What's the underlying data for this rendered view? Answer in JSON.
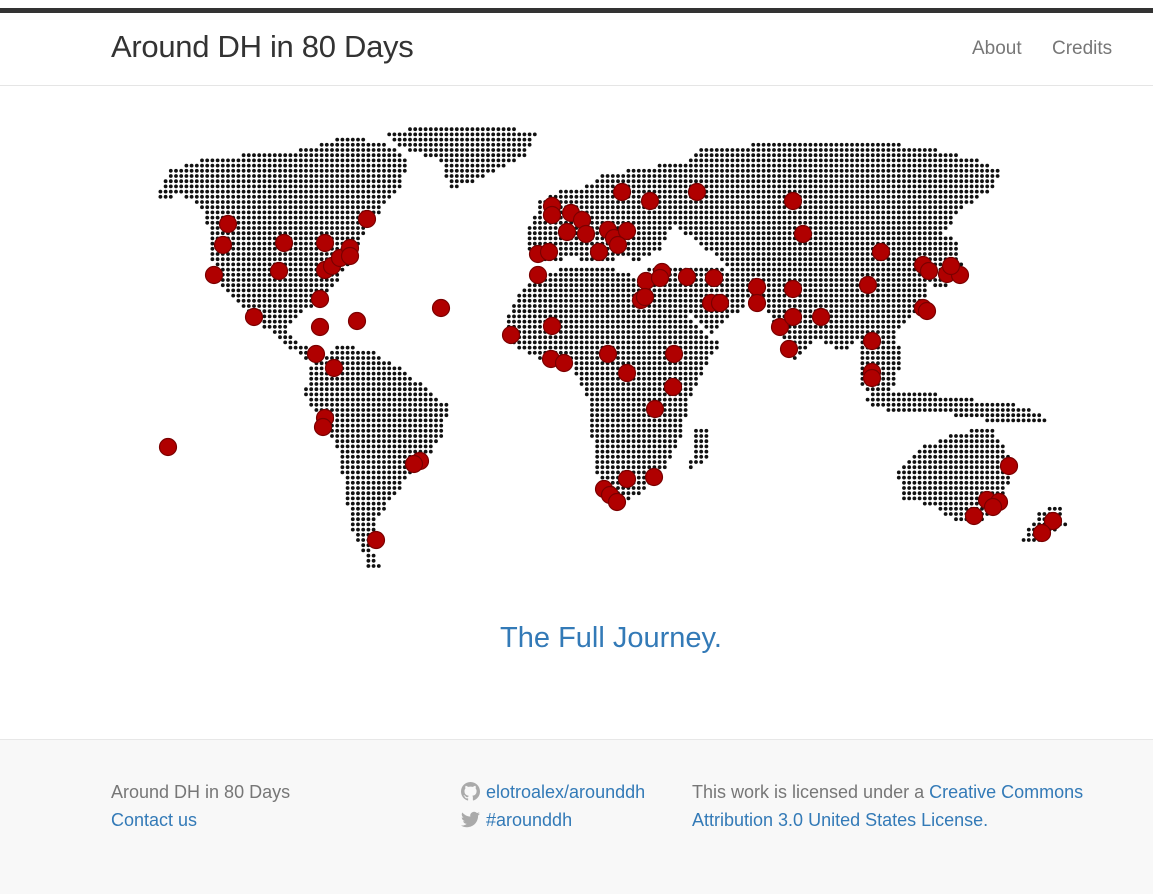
{
  "navbar": {
    "brand": "Around DH in 80 Days",
    "links": [
      "About",
      "Credits"
    ]
  },
  "map": {
    "dot_color": "#111111",
    "marker_color": "#b00000",
    "marker_stroke": "#7a0000"
  },
  "journey_link": "The Full Journey.",
  "footer": {
    "title": "Around DH in 80 Days",
    "contact": "Contact us",
    "github": "elotroalex/arounddh",
    "twitter": "#arounddh",
    "license_prefix": "This work is licensed under a ",
    "license_link": "Creative Commons Attribution 3.0 United States License."
  },
  "colors": {
    "link": "#337ab7",
    "muted": "#777777",
    "footer_bg": "#f8f8f8"
  }
}
